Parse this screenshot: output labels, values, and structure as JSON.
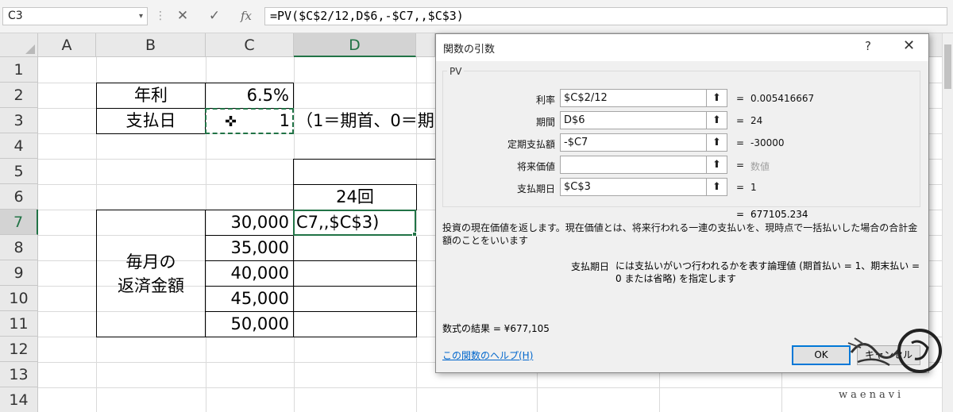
{
  "formula_bar": {
    "name_box": "C3",
    "name_box_arrow": "▾",
    "dots": "⋮",
    "cancel_icon": "✕",
    "enter_icon": "✓",
    "fx_label": "fx",
    "formula": "=PV($C$2/12,D$6,-$C7,,$C$3)"
  },
  "columns": [
    "A",
    "B",
    "C",
    "D"
  ],
  "rows": [
    "1",
    "2",
    "3",
    "4",
    "5",
    "6",
    "7",
    "8",
    "9",
    "10",
    "11",
    "12",
    "13",
    "14"
  ],
  "sheet": {
    "rate_label": "年利",
    "rate_value": "6.5%",
    "payday_label": "支払日",
    "payday_value": "1",
    "payday_note": "（1＝期首、0＝期",
    "header_24": "24回",
    "d7_edit": "C7,,$C$3)",
    "monthly_label_1": "毎月の",
    "monthly_label_2": "返済金額",
    "amounts": [
      "30,000",
      "35,000",
      "40,000",
      "45,000",
      "50,000"
    ]
  },
  "dialog": {
    "title": "関数の引数",
    "help_glyph": "?",
    "close_glyph": "✕",
    "function_name": "PV",
    "args": [
      {
        "label": "利率",
        "value": "$C$2/12",
        "result": "0.005416667"
      },
      {
        "label": "期間",
        "value": "D$6",
        "result": "24"
      },
      {
        "label": "定期支払額",
        "value": "-$C7",
        "result": "-30000"
      },
      {
        "label": "将来価値",
        "value": "",
        "result": "数値"
      },
      {
        "label": "支払期日",
        "value": "$C$3",
        "result": "1"
      }
    ],
    "ref_button_glyph": "⬆",
    "equals": "=",
    "result_value": "677105.234",
    "description": "投資の現在価値を返します。現在価値とは、将来行われる一連の支払いを、現時点で一括払いした場合の合計金額のことをいいます",
    "arg_help_label": "支払期日",
    "arg_help_text": "には支払いがいつ行われるかを表す論理値 (期首払い = 1、期末払い = 0 または省略) を指定します",
    "formula_result": "数式の結果 =  ¥677,105",
    "help_link": "この関数のヘルプ(H)",
    "ok_label": "OK",
    "cancel_label": "キャンセル"
  },
  "watermark": "waenavi"
}
